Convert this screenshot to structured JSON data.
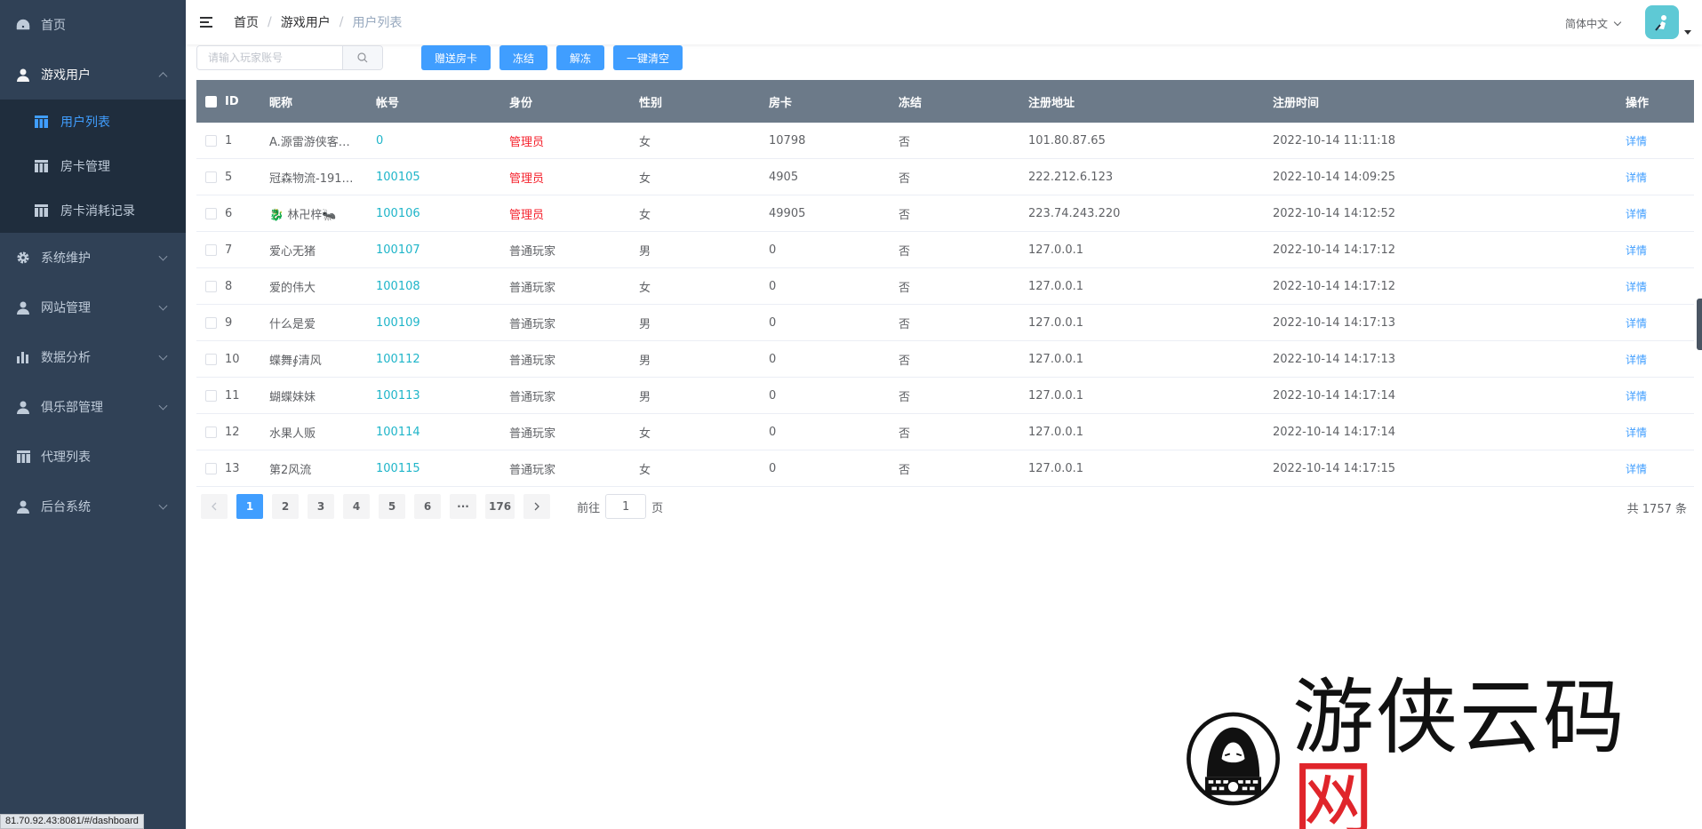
{
  "sidebar": {
    "home_label": "首页",
    "game_users": {
      "label": "游戏用户",
      "children": [
        {
          "label": "用户列表"
        },
        {
          "label": "房卡管理"
        },
        {
          "label": "房卡消耗记录"
        }
      ]
    },
    "system_label": "系统维护",
    "website_label": "网站管理",
    "analytics_label": "数据分析",
    "club_label": "俱乐部管理",
    "agent_label": "代理列表",
    "backend_label": "后台系统"
  },
  "status_url": "81.70.92.43:8081/#/dashboard",
  "header": {
    "breadcrumb": [
      "首页",
      "游戏用户",
      "用户列表"
    ],
    "language": "简体中文"
  },
  "toolbar": {
    "search_placeholder": "请输入玩家账号",
    "gift_label": "赠送房卡",
    "freeze_label": "冻结",
    "unfreeze_label": "解冻",
    "clear_label": "一键清空"
  },
  "table": {
    "headers": {
      "id": "ID",
      "nickname": "昵称",
      "account": "帐号",
      "role": "身份",
      "gender": "性别",
      "cards": "房卡",
      "frozen": "冻结",
      "ip": "注册地址",
      "time": "注册时间",
      "action": "操作"
    },
    "action_label": "详情",
    "rows": [
      {
        "id": "1",
        "nickname": "A.源雷游侠客…",
        "account": "0",
        "role": "管理员",
        "gender": "女",
        "cards": "10798",
        "frozen": "否",
        "ip": "101.80.87.65",
        "time": "2022-10-14 11:11:18"
      },
      {
        "id": "5",
        "nickname": "冠森物流-191…",
        "account": "100105",
        "role": "管理员",
        "gender": "女",
        "cards": "4905",
        "frozen": "否",
        "ip": "222.212.6.123",
        "time": "2022-10-14 14:09:25"
      },
      {
        "id": "6",
        "nickname": "🐉 林卍梓🐜",
        "account": "100106",
        "role": "管理员",
        "gender": "女",
        "cards": "49905",
        "frozen": "否",
        "ip": "223.74.243.220",
        "time": "2022-10-14 14:12:52"
      },
      {
        "id": "7",
        "nickname": "爱心无猪",
        "account": "100107",
        "role": "普通玩家",
        "gender": "男",
        "cards": "0",
        "frozen": "否",
        "ip": "127.0.0.1",
        "time": "2022-10-14 14:17:12"
      },
      {
        "id": "8",
        "nickname": "爱的伟大",
        "account": "100108",
        "role": "普通玩家",
        "gender": "女",
        "cards": "0",
        "frozen": "否",
        "ip": "127.0.0.1",
        "time": "2022-10-14 14:17:12"
      },
      {
        "id": "9",
        "nickname": "什么是爱",
        "account": "100109",
        "role": "普通玩家",
        "gender": "男",
        "cards": "0",
        "frozen": "否",
        "ip": "127.0.0.1",
        "time": "2022-10-14 14:17:13"
      },
      {
        "id": "10",
        "nickname": "蝶舞∮清风",
        "account": "100112",
        "role": "普通玩家",
        "gender": "男",
        "cards": "0",
        "frozen": "否",
        "ip": "127.0.0.1",
        "time": "2022-10-14 14:17:13"
      },
      {
        "id": "11",
        "nickname": "蝴蝶妹妹",
        "account": "100113",
        "role": "普通玩家",
        "gender": "男",
        "cards": "0",
        "frozen": "否",
        "ip": "127.0.0.1",
        "time": "2022-10-14 14:17:14"
      },
      {
        "id": "12",
        "nickname": "水果人贩",
        "account": "100114",
        "role": "普通玩家",
        "gender": "女",
        "cards": "0",
        "frozen": "否",
        "ip": "127.0.0.1",
        "time": "2022-10-14 14:17:14"
      },
      {
        "id": "13",
        "nickname": "第2风流",
        "account": "100115",
        "role": "普通玩家",
        "gender": "女",
        "cards": "0",
        "frozen": "否",
        "ip": "127.0.0.1",
        "time": "2022-10-14 14:17:15"
      }
    ]
  },
  "pagination": {
    "pages": [
      "1",
      "2",
      "3",
      "4",
      "5",
      "6",
      "···",
      "176"
    ],
    "current": "1",
    "goto_prefix": "前往",
    "goto_value": "1",
    "goto_suffix": "页",
    "total": "共 1757 条"
  },
  "watermark": {
    "text_black": "游侠云码",
    "text_red": "网"
  },
  "colors": {
    "sidebar_bg": "#304156",
    "submenu_bg": "#1f2d3d",
    "accent": "#409eff",
    "table_header_bg": "#6c7a89",
    "account_color": "#1fb5c9",
    "admin_color": "#f5222d"
  }
}
